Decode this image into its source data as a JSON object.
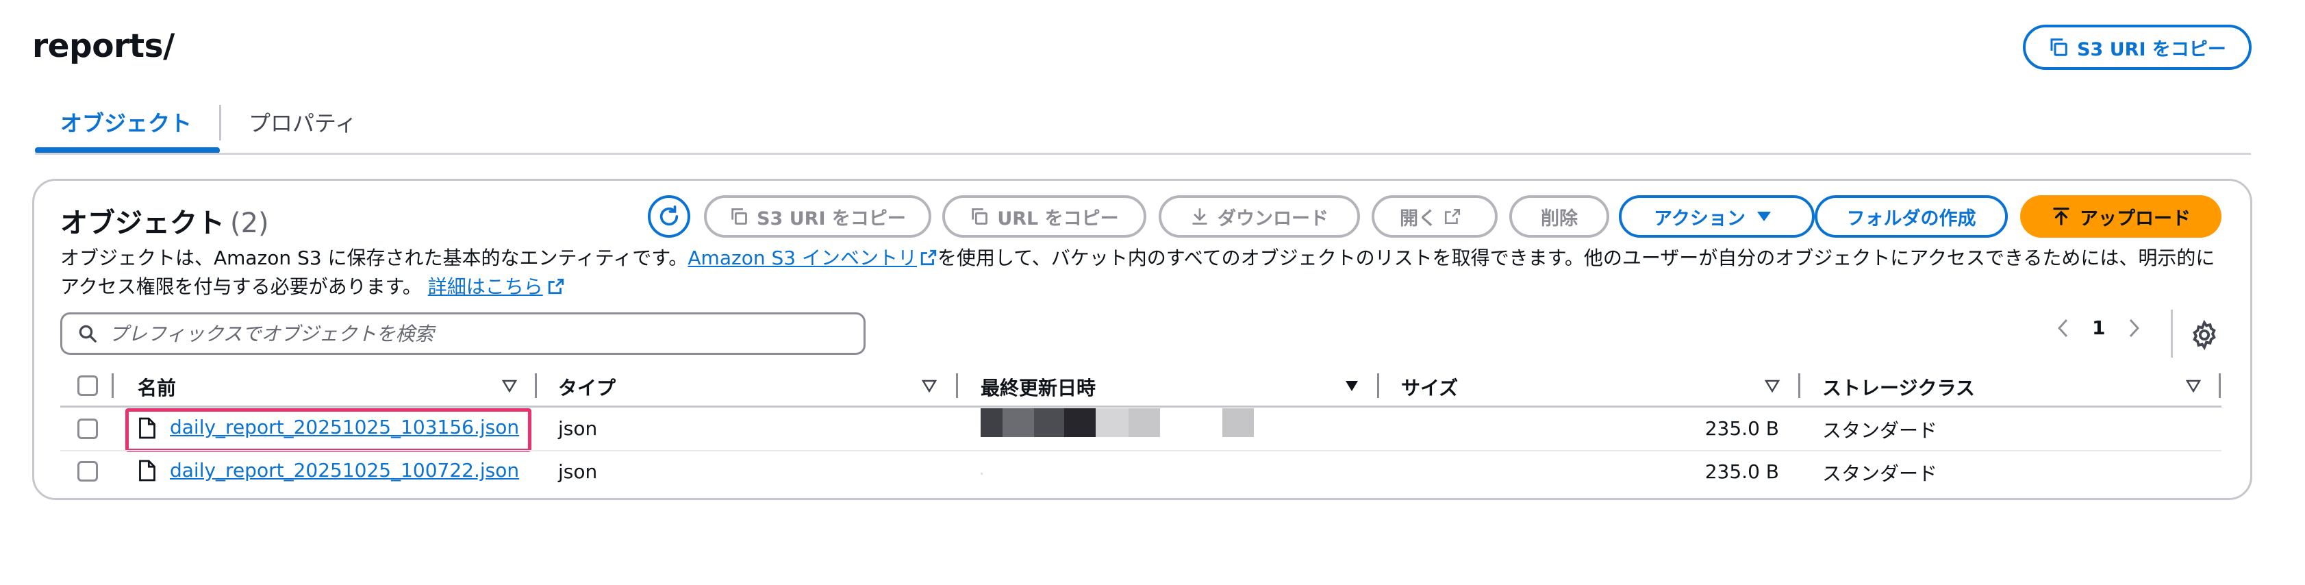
{
  "header": {
    "title": "reports/",
    "copy_uri_label": "S3 URI をコピー"
  },
  "tabs": [
    {
      "label": "オブジェクト",
      "active": true
    },
    {
      "label": "プロパティ",
      "active": false
    }
  ],
  "objects": {
    "title": "オブジェクト",
    "count": "(2)",
    "toolbar": {
      "copy_s3_uri": "S3 URI をコピー",
      "copy_url": "URL をコピー",
      "download": "ダウンロード",
      "open": "開く",
      "delete": "削除",
      "actions": "アクション",
      "create_folder": "フォルダの作成",
      "upload": "アップロード"
    },
    "description": {
      "part1": "オブジェクトは、Amazon S3 に保存された基本的なエンティティです。",
      "inventory_link": "Amazon S3 インベントリ",
      "part2": "を使用して、バケット内のすべてのオブジェクトのリストを取得できます。他のユーザーが自分のオブジェクトにアクセスできるためには、明示的にアクセス権限を付与する必要があります。",
      "details_link": "詳細はこちら"
    },
    "search_placeholder": "プレフィックスでオブジェクトを検索",
    "pagination": {
      "current_page": "1"
    },
    "columns": [
      "名前",
      "タイプ",
      "最終更新日時",
      "サイズ",
      "ストレージクラス"
    ],
    "rows": [
      {
        "name": "daily_report_20251025_103156.json",
        "type": "json",
        "size": "235.0 B",
        "storage_class": "スタンダード"
      },
      {
        "name": "daily_report_20251025_100722.json",
        "type": "json",
        "size": "235.0 B",
        "storage_class": "スタンダード"
      }
    ]
  },
  "colors": {
    "accent": "#0972d3",
    "upload": "#ff9900",
    "highlight": "#e8336d"
  }
}
